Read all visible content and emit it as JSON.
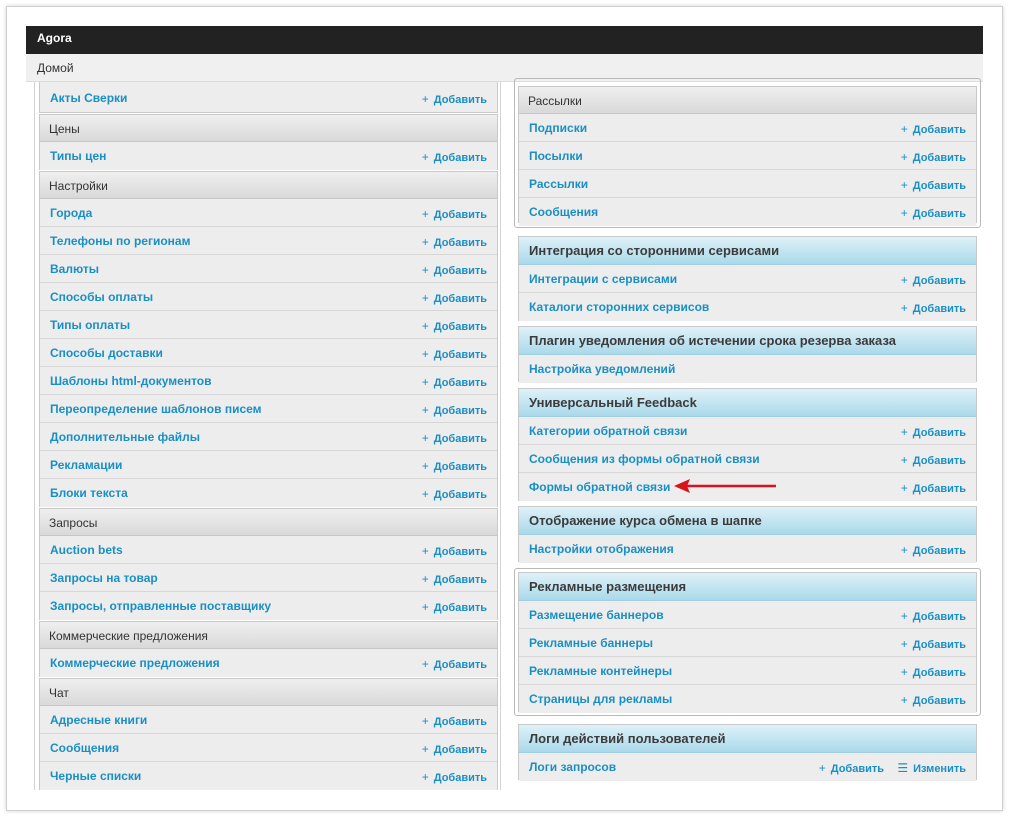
{
  "app": {
    "title": "Agora",
    "breadcrumb": "Домой"
  },
  "actions": {
    "add": "Добавить",
    "edit": "Изменить"
  },
  "colors": {
    "accent": "#1a8fc4",
    "header_blue": "#aad9ea",
    "arrow": "#d9131b"
  },
  "left": {
    "top_row": "Акты Сверки",
    "sections": [
      {
        "title": "Цены",
        "items": [
          "Типы цен"
        ]
      },
      {
        "title": "Настройки",
        "items": [
          "Города",
          "Телефоны по регионам",
          "Валюты",
          "Способы оплаты",
          "Типы оплаты",
          "Способы доставки",
          "Шаблоны html-документов",
          "Переопределение шаблонов писем",
          "Дополнительные файлы",
          "Рекламации",
          "Блоки текста"
        ]
      },
      {
        "title": "Запросы",
        "items": [
          "Auction bets",
          "Запросы на товар",
          "Запросы, отправленные поставщику"
        ]
      },
      {
        "title": "Коммерческие предложения",
        "items": [
          "Коммерческие предложения"
        ]
      },
      {
        "title": "Чат",
        "items": [
          "Адресные книги",
          "Сообщения",
          "Черные списки"
        ]
      }
    ]
  },
  "right": {
    "mailing": {
      "title": "Рассылки",
      "items": [
        "Подписки",
        "Посылки",
        "Рассылки",
        "Сообщения"
      ]
    },
    "integration": {
      "title": "Интеграция со сторонними сервисами",
      "items": [
        "Интеграции с сервисами",
        "Каталоги сторонних сервисов"
      ]
    },
    "plugin": {
      "title": "Плагин уведомления об истечении срока резерва заказа",
      "items": [
        "Настройка уведомлений"
      ]
    },
    "feedback": {
      "title": "Универсальный Feedback",
      "items": [
        "Категории обратной связи",
        "Сообщения из формы обратной связи",
        "Формы обратной связи"
      ]
    },
    "currency": {
      "title": "Отображение курса обмена в шапке",
      "items": [
        "Настройки отображения"
      ]
    },
    "ads": {
      "title": "Рекламные размещения",
      "items": [
        "Размещение баннеров",
        "Рекламные баннеры",
        "Рекламные контейнеры",
        "Страницы для рекламы"
      ]
    },
    "logs": {
      "title": "Логи действий пользователей",
      "items": [
        "Логи запросов"
      ]
    }
  }
}
